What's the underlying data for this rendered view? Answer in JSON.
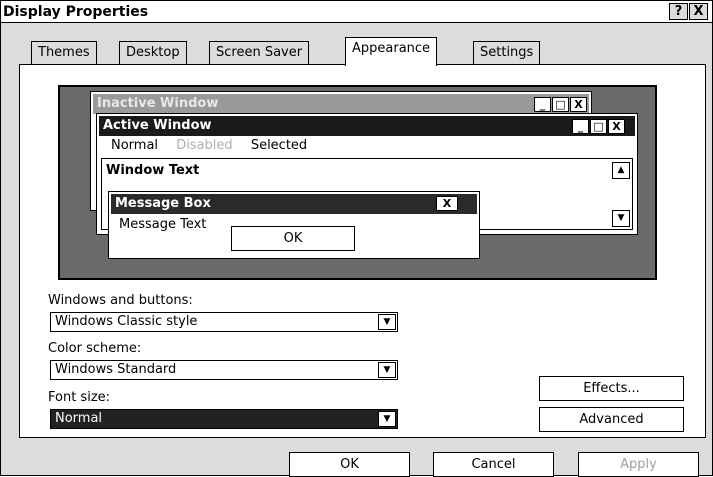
{
  "window": {
    "title": "Display Properties",
    "help_label": "?",
    "close_label": "X"
  },
  "tabs": [
    {
      "label": "Themes"
    },
    {
      "label": "Desktop"
    },
    {
      "label": "Screen Saver"
    },
    {
      "label": "Appearance"
    },
    {
      "label": "Settings"
    }
  ],
  "preview": {
    "inactive_title": "Inactive Window",
    "active_title": "Active Window",
    "menu": {
      "normal": "Normal",
      "disabled": "Disabled",
      "selected": "Selected"
    },
    "window_text": "Window Text",
    "message_box": {
      "title": "Message Box",
      "text": "Message Text",
      "ok_label": "OK",
      "close_label": "X"
    },
    "min_label": "_",
    "max_label": "□",
    "close_label": "X",
    "colors": {
      "desktop": "#6a6a6a",
      "active_title": "#1a1a1a",
      "inactive_title": "#9a9a9a"
    }
  },
  "form": {
    "windows_buttons_label": "Windows and buttons:",
    "windows_buttons_value": "Windows Classic style",
    "color_scheme_label": "Color scheme:",
    "color_scheme_value": "Windows Standard",
    "font_size_label": "Font size:",
    "font_size_value": "Normal",
    "effects_label": "Effects...",
    "advanced_label": "Advanced"
  },
  "footer": {
    "ok_label": "OK",
    "cancel_label": "Cancel",
    "apply_label": "Apply"
  }
}
